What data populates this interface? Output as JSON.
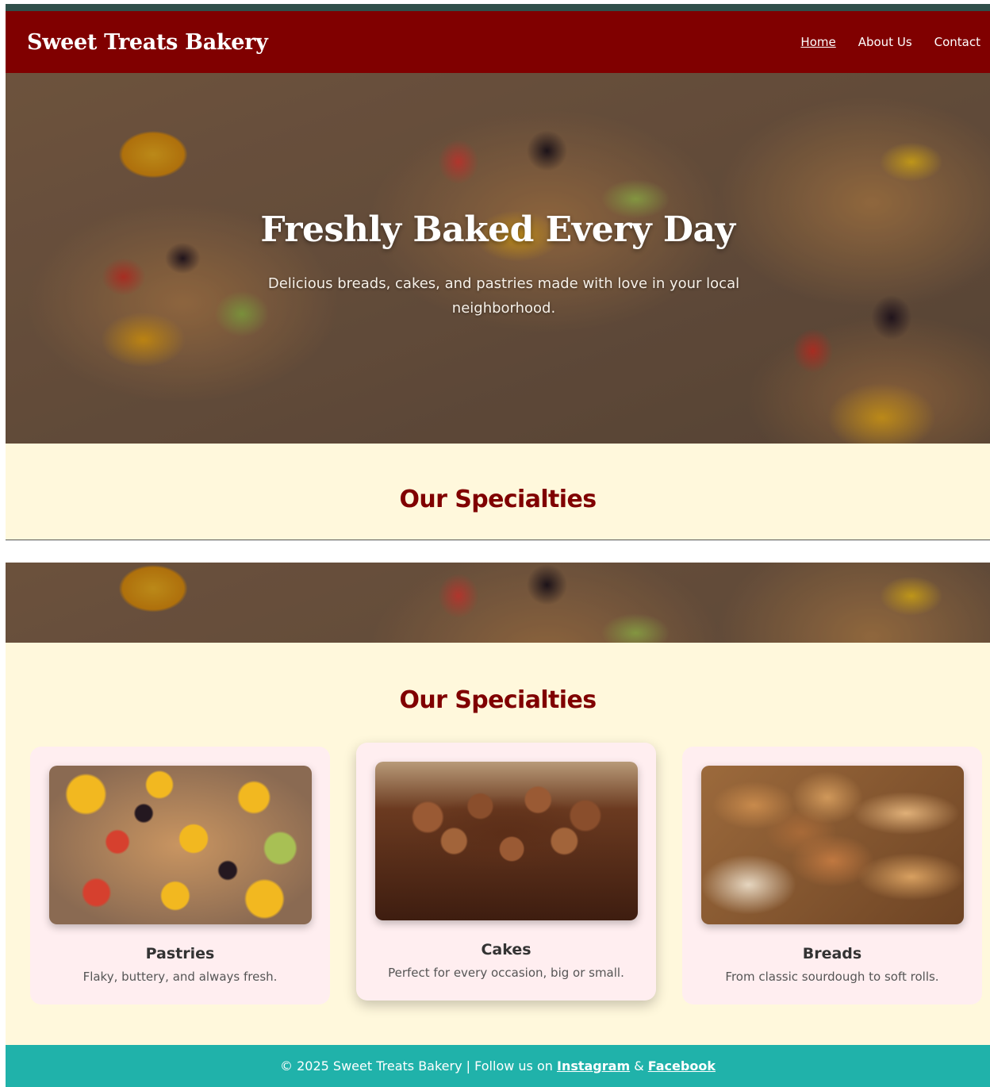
{
  "navbar": {
    "brand": "Sweet Treats Bakery",
    "links": [
      "Home",
      "About Us",
      "Contact"
    ]
  },
  "hero": {
    "title": "Freshly Baked Every Day",
    "subtitle": "Delicious breads, cakes, and pastries made with love in your local neighborhood."
  },
  "specialties": {
    "title": "Our Specialties",
    "cards": [
      {
        "title": "Pastries",
        "description": "Flaky, buttery, and always fresh."
      },
      {
        "title": "Cakes",
        "description": "Perfect for every occasion, big or small."
      },
      {
        "title": "Breads",
        "description": "From classic sourdough to soft rolls."
      }
    ]
  },
  "footer": {
    "text": "© 2025 Sweet Treats Bakery | Follow us on ",
    "instagram": "Instagram",
    "separator": " & ",
    "facebook": "Facebook"
  },
  "colors": {
    "navbar": "#800000",
    "section_bg": "#fff8dc",
    "card_bg": "#ffeef0",
    "footer": "#20b2aa",
    "heading": "#800000"
  }
}
